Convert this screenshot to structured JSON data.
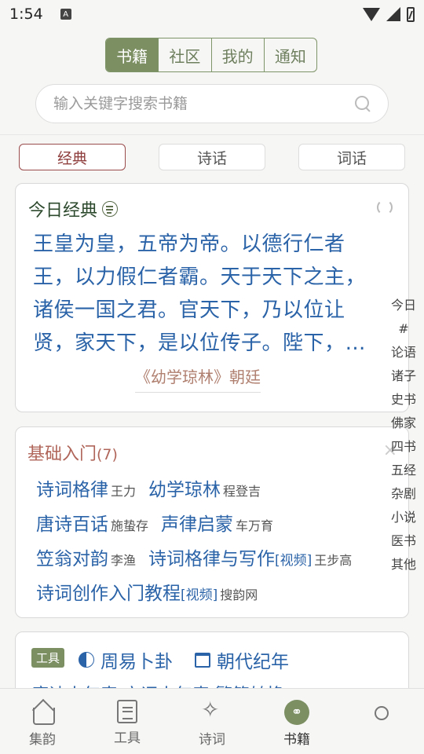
{
  "status": {
    "time": "1:54",
    "a_badge": "A"
  },
  "top_tabs": [
    {
      "label": "书籍",
      "active": true
    },
    {
      "label": "社区",
      "active": false
    },
    {
      "label": "我的",
      "active": false
    },
    {
      "label": "通知",
      "active": false
    }
  ],
  "search": {
    "placeholder": "输入关键字搜索书籍"
  },
  "category_tabs": [
    {
      "label": "经典",
      "active": true
    },
    {
      "label": "诗话",
      "active": false
    },
    {
      "label": "词话",
      "active": false
    }
  ],
  "daily": {
    "title": "今日经典",
    "text": "王皇为皇，五帝为帝。以德行仁者王，以力假仁者霸。天于天下之主，诸侯一国之君。官天下，乃以位让贤，家天下，是以位传子。陛下，…",
    "source": "《幼学琼林》朝廷"
  },
  "basics": {
    "title": "基础入门",
    "count": "(7)",
    "close": "×",
    "rows": [
      [
        {
          "title": "诗词格律",
          "tag": "",
          "author": "王力"
        },
        {
          "title": "幼学琼林",
          "tag": "",
          "author": "程登吉"
        }
      ],
      [
        {
          "title": "唐诗百话",
          "tag": "",
          "author": "施蛰存"
        },
        {
          "title": "声律启蒙",
          "tag": "",
          "author": "车万育"
        }
      ],
      [
        {
          "title": "笠翁对韵",
          "tag": "",
          "author": "李渔"
        },
        {
          "title": "诗词格律与写作",
          "tag": "[视频]",
          "author": "王步高"
        }
      ],
      [
        {
          "title": "诗词创作入门教程",
          "tag": "[视频]",
          "author": "搜韵网"
        }
      ]
    ]
  },
  "tools": {
    "badge": "工具",
    "item1": "周易卜卦",
    "item2": "朝代纪年",
    "row2": "唐诗人年表  宋词人年表  繁简转换"
  },
  "side_index": [
    "今日",
    "#",
    "论语",
    "诸子",
    "史书",
    "佛家",
    "四书",
    "五经",
    "杂剧",
    "小说",
    "医书",
    "其他"
  ],
  "bottom_nav": [
    {
      "label": "集韵",
      "icon": "home-icon"
    },
    {
      "label": "工具",
      "icon": "list-icon"
    },
    {
      "label": "诗词",
      "icon": "sparkle-icon"
    },
    {
      "label": "书籍",
      "icon": "link-icon",
      "active": true
    },
    {
      "label": "",
      "icon": "circle-icon"
    }
  ],
  "colors": {
    "accent": "#7b8f63",
    "link": "#2b63a8",
    "active_border": "#9a4b4b"
  }
}
